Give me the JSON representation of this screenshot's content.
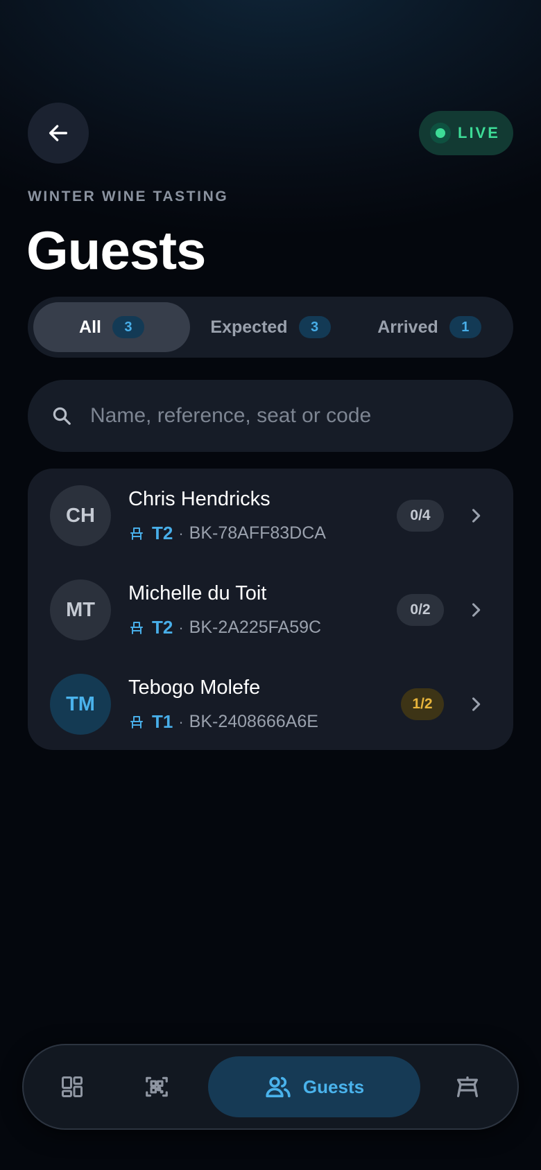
{
  "header": {
    "back_icon": "arrow-left-icon",
    "live_label": "LIVE",
    "live_color": "#3ddc97",
    "eyebrow": "WINTER WINE TASTING",
    "title": "Guests"
  },
  "tabs": [
    {
      "label": "All",
      "count": "3",
      "active": true
    },
    {
      "label": "Expected",
      "count": "3",
      "active": false
    },
    {
      "label": "Arrived",
      "count": "1",
      "active": false
    }
  ],
  "search": {
    "icon": "search-icon",
    "placeholder": "Name, reference, seat or code",
    "value": ""
  },
  "guests": [
    {
      "initials": "CH",
      "name": "Chris Hendricks",
      "seat_icon": "seat-icon",
      "table": "T2",
      "separator": "·",
      "reference": "BK-78AFF83DCA",
      "checked_in": "0/4",
      "status": "none"
    },
    {
      "initials": "MT",
      "name": "Michelle du Toit",
      "seat_icon": "seat-icon",
      "table": "T2",
      "separator": "·",
      "reference": "BK-2A225FA59C",
      "checked_in": "0/2",
      "status": "none"
    },
    {
      "initials": "TM",
      "name": "Tebogo Molefe",
      "seat_icon": "seat-icon",
      "table": "T1",
      "separator": "·",
      "reference": "BK-2408666A6E",
      "checked_in": "1/2",
      "status": "partial"
    }
  ],
  "bottom_nav": {
    "items": [
      {
        "icon": "dashboard-icon",
        "label": ""
      },
      {
        "icon": "qr-scan-icon",
        "label": ""
      },
      {
        "icon": "users-icon",
        "label": "Guests",
        "active": true
      },
      {
        "icon": "table-icon",
        "label": ""
      }
    ]
  },
  "colors": {
    "accent": "#48aee8",
    "live": "#3ddc97",
    "partial": "#e8b53c",
    "background": "#04070d"
  }
}
